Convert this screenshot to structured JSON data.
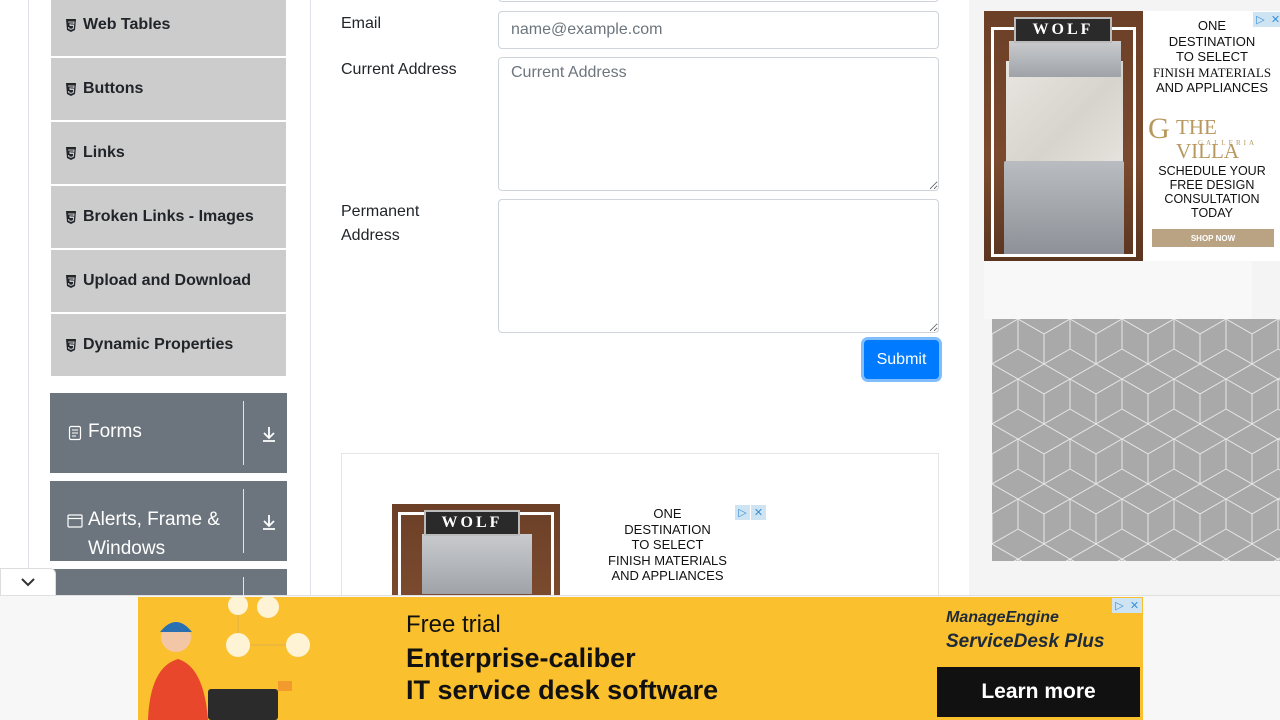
{
  "sidebar": {
    "items": [
      {
        "label": "Web Tables"
      },
      {
        "label": "Buttons"
      },
      {
        "label": "Links"
      },
      {
        "label": "Broken Links - Images"
      },
      {
        "label": "Upload and Download"
      },
      {
        "label": "Dynamic Properties"
      }
    ],
    "groups": [
      {
        "title": "Forms"
      },
      {
        "title_line1": "Alerts, Frame &",
        "title_line2": "Windows"
      }
    ]
  },
  "form": {
    "email_label": "Email",
    "email_placeholder": "name@example.com",
    "current_address_label": "Current Address",
    "current_address_placeholder": "Current Address",
    "permanent_address_label_line1": "Permanent",
    "permanent_address_label_line2": "Address",
    "submit_label": "Submit"
  },
  "ads": {
    "brand_logo": "WOLF",
    "villa_text_lines": [
      "ONE",
      "DESTINATION",
      "TO SELECT",
      "FINISH MATERIALS",
      "AND APPLIANCES"
    ],
    "villa_brand": "THE VILLA",
    "villa_sub": "GALLERIA",
    "villa_cta_lines": [
      "SCHEDULE YOUR",
      "FREE DESIGN",
      "CONSULTATION",
      "TODAY"
    ],
    "shop_now": "SHOP NOW",
    "banner": {
      "line1": "Free trial",
      "line2": "Enterprise-caliber",
      "line3": "IT service desk software",
      "brand_line1": "ManageEngine",
      "brand_line2": "ServiceDesk Plus",
      "cta": "Learn more"
    }
  },
  "colors": {
    "primary": "#007bff",
    "sidebar_item_bg": "#cccccc",
    "group_header_bg": "#6c757d",
    "banner_bg": "#fbc02d"
  }
}
